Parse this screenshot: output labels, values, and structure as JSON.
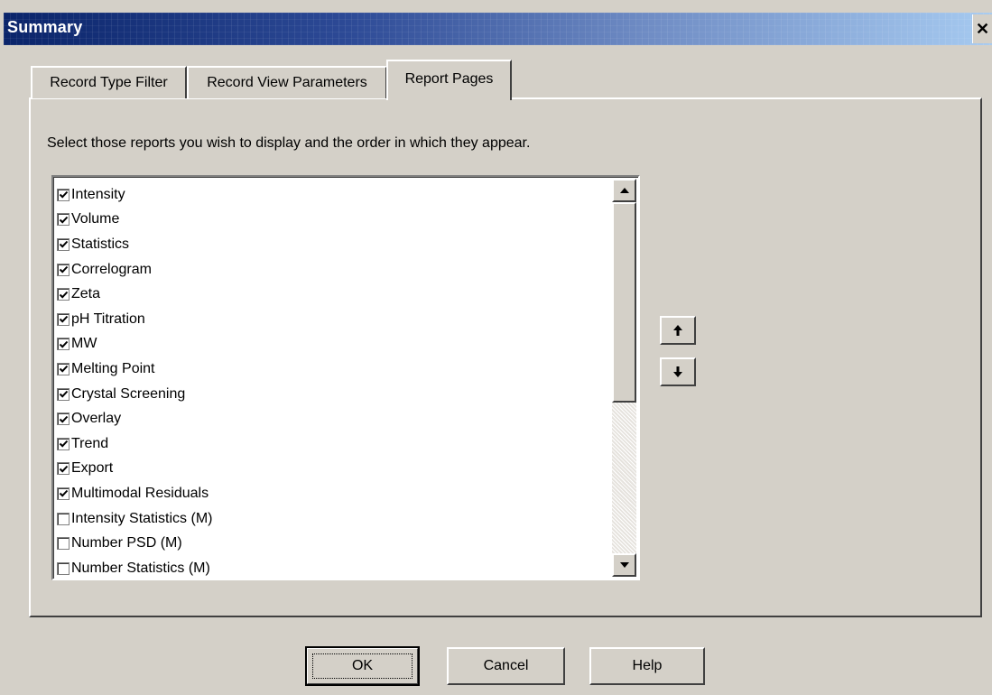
{
  "window": {
    "title": "Summary",
    "close_glyph": "✕"
  },
  "tabs": [
    {
      "label": "Record Type Filter",
      "active": false
    },
    {
      "label": "Record View Parameters",
      "active": false
    },
    {
      "label": "Report Pages",
      "active": true
    }
  ],
  "report_pages": {
    "instruction": "Select those reports you wish to display and the order in which they appear.",
    "items": [
      {
        "label": "Intensity",
        "checked": true
      },
      {
        "label": "Volume",
        "checked": true
      },
      {
        "label": "Statistics",
        "checked": true
      },
      {
        "label": "Correlogram",
        "checked": true
      },
      {
        "label": "Zeta",
        "checked": true
      },
      {
        "label": "pH Titration",
        "checked": true
      },
      {
        "label": "MW",
        "checked": true
      },
      {
        "label": "Melting Point",
        "checked": true
      },
      {
        "label": "Crystal Screening",
        "checked": true
      },
      {
        "label": "Overlay",
        "checked": true
      },
      {
        "label": "Trend",
        "checked": true
      },
      {
        "label": "Export",
        "checked": true
      },
      {
        "label": "Multimodal Residuals",
        "checked": true
      },
      {
        "label": "Intensity Statistics (M)",
        "checked": false
      },
      {
        "label": "Number PSD (M)",
        "checked": false
      },
      {
        "label": "Number Statistics (M)",
        "checked": false
      }
    ],
    "move_up_icon": "arrow-up-icon",
    "move_down_icon": "arrow-down-icon"
  },
  "buttons": {
    "ok": "OK",
    "cancel": "Cancel",
    "help": "Help"
  },
  "colors": {
    "face": "#d4d0c8",
    "titlebar_start": "#0a246a",
    "titlebar_end": "#a6caf0"
  }
}
